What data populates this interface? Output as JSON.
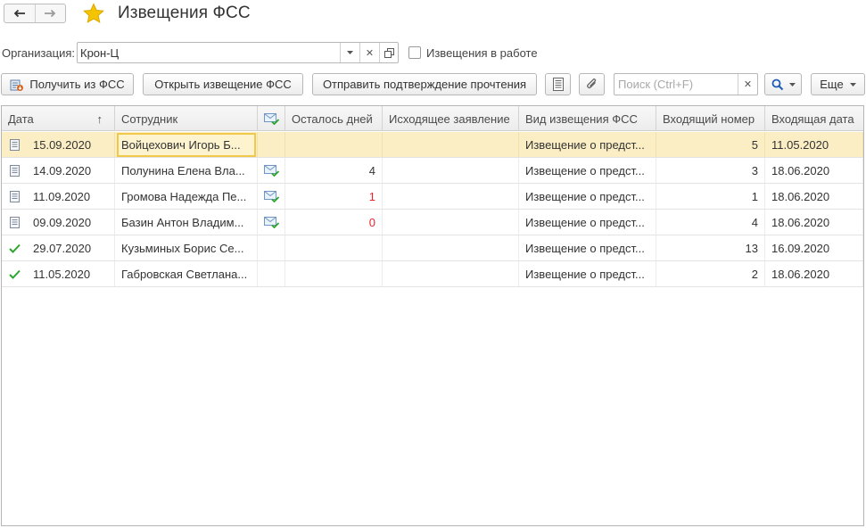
{
  "window": {
    "title": "Извещения ФСС"
  },
  "filter": {
    "org_label": "Организация:",
    "org_value": "Крон-Ц",
    "in_work_label": "Извещения в работе",
    "in_work_checked": false
  },
  "toolbar": {
    "get_label": "Получить из ФСС",
    "open_label": "Открыть извещение ФСС",
    "send_label": "Отправить подтверждение прочтения",
    "search_placeholder": "Поиск (Ctrl+F)",
    "more_label": "Еще"
  },
  "table": {
    "columns": {
      "date": "Дата",
      "employee": "Сотрудник",
      "days_left": "Осталось дней",
      "outgoing": "Исходящее заявление",
      "type": "Вид извещения ФСС",
      "in_number": "Входящий номер",
      "in_date": "Входящая дата"
    },
    "sort_indicator": "↑",
    "rows": [
      {
        "status": "document",
        "date": "15.09.2020",
        "employee": "Войцехович Игорь Б...",
        "mail": false,
        "days_left": "",
        "days_left_red": false,
        "outgoing": "",
        "type": "Извещение о предст...",
        "in_number": "5",
        "in_date": "11.05.2020",
        "selected": true
      },
      {
        "status": "document",
        "date": "14.09.2020",
        "employee": "Полунина Елена Вла...",
        "mail": true,
        "days_left": "4",
        "days_left_red": false,
        "outgoing": "",
        "type": "Извещение о предст...",
        "in_number": "3",
        "in_date": "18.06.2020",
        "selected": false
      },
      {
        "status": "document",
        "date": "11.09.2020",
        "employee": "Громова Надежда Пе...",
        "mail": true,
        "days_left": "1",
        "days_left_red": true,
        "outgoing": "",
        "type": "Извещение о предст...",
        "in_number": "1",
        "in_date": "18.06.2020",
        "selected": false
      },
      {
        "status": "document",
        "date": "09.09.2020",
        "employee": "Базин Антон Владим...",
        "mail": true,
        "days_left": "0",
        "days_left_red": true,
        "outgoing": "",
        "type": "Извещение о предст...",
        "in_number": "4",
        "in_date": "18.06.2020",
        "selected": false
      },
      {
        "status": "done",
        "date": "29.07.2020",
        "employee": "Кузьминых Борис Се...",
        "mail": false,
        "days_left": "",
        "days_left_red": false,
        "outgoing": "",
        "type": "Извещение о предст...",
        "in_number": "13",
        "in_date": "16.09.2020",
        "selected": false
      },
      {
        "status": "done",
        "date": "11.05.2020",
        "employee": "Габровская Светлана...",
        "mail": false,
        "days_left": "",
        "days_left_red": false,
        "outgoing": "",
        "type": "Извещение о предст...",
        "in_number": "2",
        "in_date": "18.06.2020",
        "selected": false
      }
    ]
  },
  "colors": {
    "selected_row": "#fbeec4",
    "focus_border": "#f2c84b",
    "warning_text": "#e8242a",
    "check_green": "#2aa52a",
    "star_yellow": "#f5c400"
  },
  "icons": {
    "back": "arrow-left-icon",
    "forward": "arrow-right-icon",
    "favorite": "star-icon",
    "get_from_fss": "download-fss-icon",
    "report": "report-icon",
    "attach": "paperclip-icon",
    "search": "magnifier-icon",
    "mail": "mail-check-icon",
    "document": "document-icon",
    "done": "checkmark-icon"
  }
}
